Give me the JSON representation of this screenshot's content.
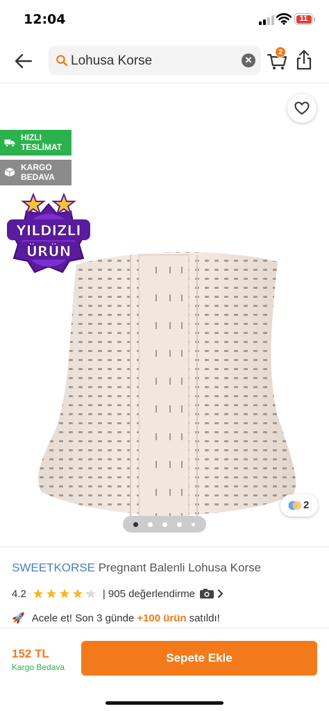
{
  "status_bar": {
    "time": "12:04",
    "battery": "11"
  },
  "search": {
    "query": "Lohusa Korse"
  },
  "header": {
    "cart_count": "2"
  },
  "gallery": {
    "badges": {
      "fast_delivery": [
        "HIZLI",
        "TESLİMAT"
      ],
      "free_shipping": [
        "KARGO",
        "BEDAVA"
      ],
      "star_product": [
        "YILDIZLI",
        "ÜRÜN"
      ]
    },
    "color_count": "2",
    "pages": 5,
    "active_page": 1
  },
  "product": {
    "brand": "SWEETKORSE",
    "name": "Pregnant Balenli Lohusa Korse",
    "rating": "4.2",
    "rating_value": 4.2,
    "reviews": "| 905 değerlendirme",
    "promo_prefix": "Acele et! Son 3 günde",
    "promo_highlight": "+100 ürün",
    "promo_suffix": "satıldı!"
  },
  "bottom": {
    "price": "152 TL",
    "shipping": "Kargo Bedava",
    "add_to_cart": "Sepete Ekle"
  },
  "colors": {
    "accent": "#f27a1a",
    "brand": "#4a7fc1",
    "green": "#2cb24d",
    "star": "#f5b823"
  }
}
